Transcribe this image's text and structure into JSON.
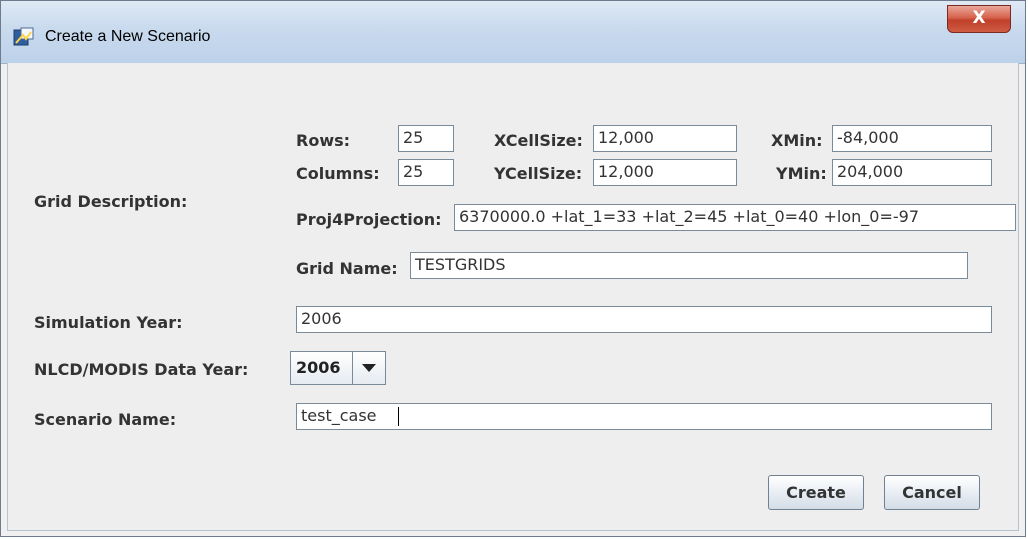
{
  "window": {
    "title": "Create a New Scenario",
    "close_label": "X"
  },
  "grid": {
    "section_label": "Grid Description:",
    "rows_label": "Rows:",
    "rows_value": "25",
    "columns_label": "Columns:",
    "columns_value": "25",
    "xcellsize_label": "XCellSize:",
    "xcellsize_value": "12,000",
    "ycellsize_label": "YCellSize:",
    "ycellsize_value": "12,000",
    "xmin_label": "XMin:",
    "xmin_value": "-84,000",
    "ymin_label": "YMin:",
    "ymin_value": "204,000",
    "proj_label": "Proj4Projection:",
    "proj_value": "6370000.0 +lat_1=33 +lat_2=45 +lat_0=40 +lon_0=-97",
    "gridname_label": "Grid Name:",
    "gridname_value": "TESTGRIDS"
  },
  "simulation": {
    "label": "Simulation Year:",
    "value": "2006"
  },
  "nlcd": {
    "label": "NLCD/MODIS Data Year:",
    "selected": "2006"
  },
  "scenario": {
    "label": "Scenario Name:",
    "value": "test_case"
  },
  "buttons": {
    "create": "Create",
    "cancel": "Cancel"
  },
  "colors": {
    "dialog_bg": "#eeeeee",
    "titlebar": "#c9daee",
    "close_button": "#c9503a",
    "label_text": "#333333"
  }
}
